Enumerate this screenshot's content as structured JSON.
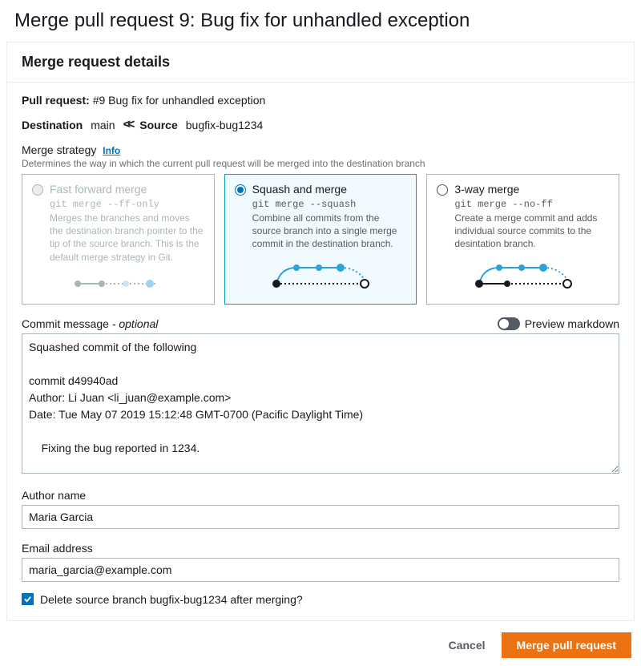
{
  "page_title": "Merge pull request 9: Bug fix for unhandled exception",
  "panel_title": "Merge request details",
  "pull_request": {
    "label": "Pull request:",
    "summary": "#9 Bug fix for unhandled exception"
  },
  "branches": {
    "destination_label": "Destination",
    "destination": "main",
    "source_label": "Source",
    "source": "bugfix-bug1234"
  },
  "strategy": {
    "label": "Merge strategy",
    "info": "Info",
    "sub": "Determines the way in which the current pull request will be merged into the destination branch",
    "options": [
      {
        "title": "Fast forward merge",
        "cmd": "git merge --ff-only",
        "desc": "Merges the branches and moves the destination branch pointer to the tip of the source branch. This is the default merge strategy in Git."
      },
      {
        "title": "Squash and merge",
        "cmd": "git merge --squash",
        "desc": "Combine all commits from the source branch into a single merge commit in the destination branch."
      },
      {
        "title": "3-way merge",
        "cmd": "git merge --no-ff",
        "desc": "Create a merge commit and adds individual source commits to the desintation branch."
      }
    ]
  },
  "commit": {
    "label": "Commit message",
    "optional": "- optional",
    "preview_label": "Preview markdown",
    "message": "Squashed commit of the following\n\ncommit d49940ad\nAuthor: Li Juan <li_juan@example.com>\nDate: Tue May 07 2019 15:12:48 GMT-0700 (Pacific Daylight Time)\n\n    Fixing the bug reported in 1234."
  },
  "author": {
    "label": "Author name",
    "value": "Maria Garcia"
  },
  "email": {
    "label": "Email address",
    "value": "maria_garcia@example.com"
  },
  "delete_branch": {
    "label": "Delete source branch bugfix-bug1234 after merging?"
  },
  "footer": {
    "cancel": "Cancel",
    "merge": "Merge pull request"
  }
}
